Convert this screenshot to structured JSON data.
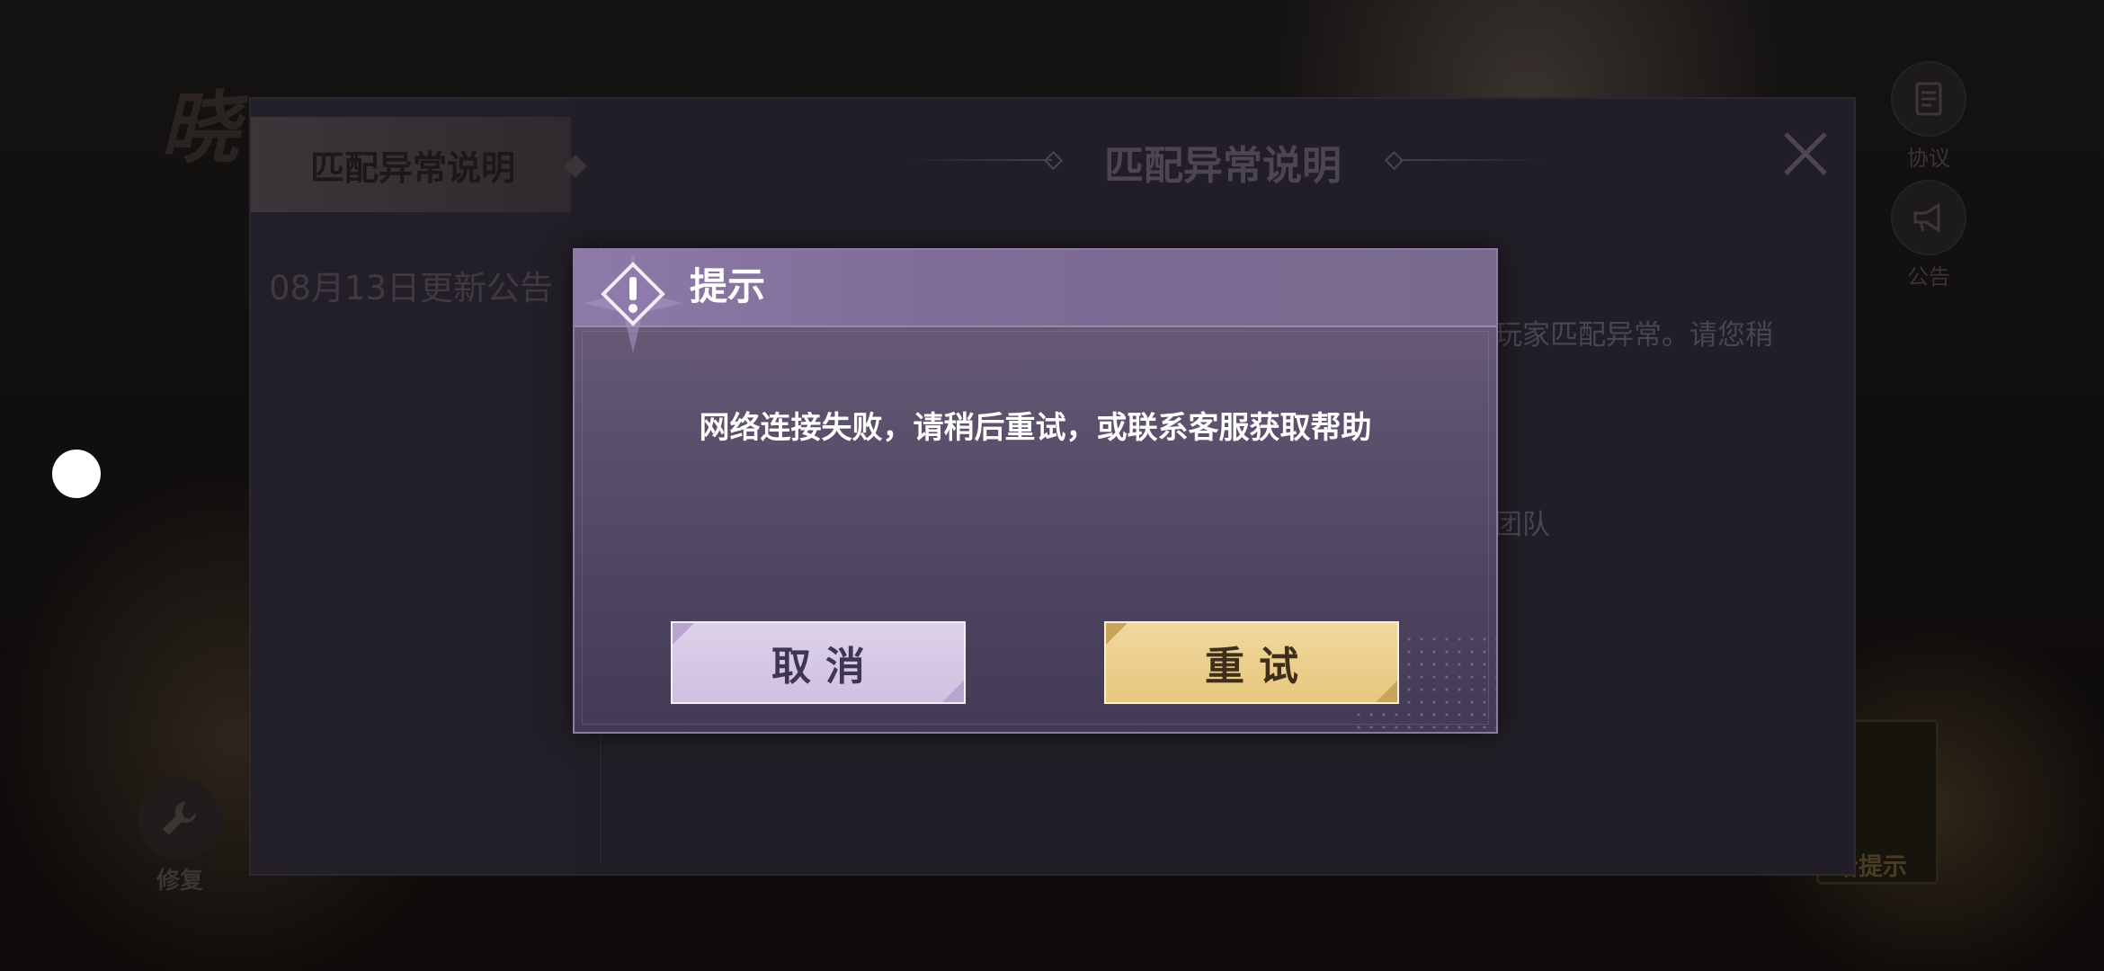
{
  "panel": {
    "sidebar_tabs": [
      {
        "label": "匹配异常说明",
        "active": true
      },
      {
        "label": "08月13日更新公告"
      }
    ],
    "title": "匹配异常说明",
    "body_fragments": [
      "玩家匹配异常。请您稍",
      "团队"
    ]
  },
  "background": {
    "logo_text": "晓",
    "side_buttons": [
      {
        "label": "协议",
        "icon": "document-icon"
      },
      {
        "label": "公告",
        "icon": "megaphone-icon"
      }
    ],
    "repair_label": "修复",
    "hint_label": "给提示"
  },
  "dialog": {
    "title": "提示",
    "message": "网络连接失败，请稍后重试，或联系客服获取帮助",
    "cancel_label": "取消",
    "retry_label": "重试"
  },
  "colors": {
    "dialog_header": "#8e7aa8",
    "cancel_button": "#ddd1ea",
    "retry_button": "#f1d89e"
  }
}
